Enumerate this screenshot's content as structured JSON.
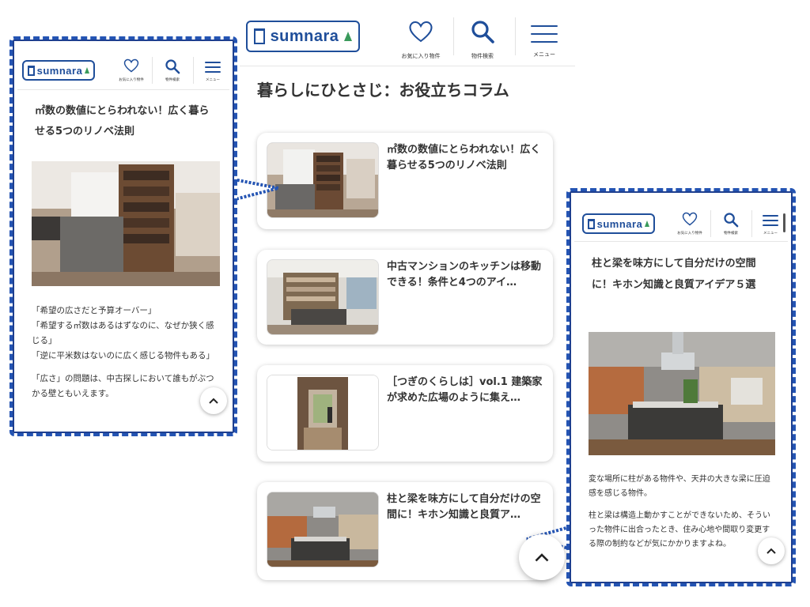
{
  "brand": {
    "logo_text": "sumnara",
    "color": "#1f4e9a",
    "accent_green": "#3a9a5b"
  },
  "header": {
    "favorites_label": "お気に入り物件",
    "search_label": "物件検索",
    "menu_label": "メニュー",
    "icons": {
      "favorites": "heart-icon",
      "search": "search-icon",
      "menu": "hamburger-menu-icon"
    }
  },
  "page": {
    "title": "暮らしにひとさじ：お役立ちコラム",
    "cards": [
      {
        "title": "㎡数の数値にとらわれない！広く暮らせる5つのリノベ法則",
        "thumb": "living-room-bookshelf-photo"
      },
      {
        "title": "中古マンションのキッチンは移動できる！条件と4つのアイ…",
        "thumb": "kitchen-shelves-photo"
      },
      {
        "title": "［つぎのくらしは］vol.1 建築家が求めた広場のように集え…",
        "thumb": "narrow-corridor-photo"
      },
      {
        "title": "柱と梁を味方にして自分だけの空間に！キホン知識と良質ア…",
        "thumb": "open-kitchen-photo"
      }
    ],
    "scroll_top_icon": "chevron-up-icon"
  },
  "left_article": {
    "title": "㎡数の数値にとらわれない！広く暮らせる5つのリノベ法則",
    "paragraphs": [
      "「希望の広さだと予算オーバー」",
      "「希望する㎡数はあるはずなのに、なぜか狭く感じる」",
      "「逆に平米数はないのに広く感じる物件もある」",
      "「広さ」の問題は、中古探しにおいて誰もがぶつかる壁ともいえます。"
    ]
  },
  "right_article": {
    "title": "柱と梁を味方にして自分だけの空間に！キホン知識と良質アイデア５選",
    "paragraphs": [
      "変な場所に柱がある物件や、天井の大きな梁に圧迫感を感じる物件。",
      "柱と梁は構造上動かすことができないため、そういった物件に出合ったとき、住み心地や間取り変更する際の制約などが気にかかりますよね。"
    ]
  },
  "colors": {
    "callout_border": "#2454b3",
    "text": "#333333",
    "card_shadow": "#cccccc"
  }
}
